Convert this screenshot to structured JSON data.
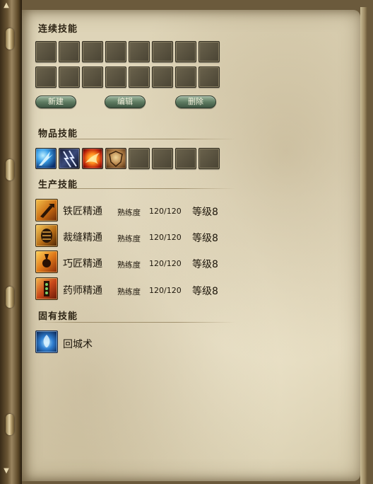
{
  "sections": {
    "combo": "连续技能",
    "item": "物品技能",
    "production": "生产技能",
    "innate": "固有技能"
  },
  "buttons": {
    "new": "新建",
    "edit": "编辑",
    "delete": "删除"
  },
  "item_skill_icons": [
    "ice-spike-icon",
    "lightning-claw-icon",
    "fire-phoenix-icon",
    "golden-shield-icon"
  ],
  "production_skills": [
    {
      "name": "铁匠精通",
      "prof_label": "熟练度",
      "prof_value": "120/120",
      "level": "等级8",
      "icon": "blacksmith-icon"
    },
    {
      "name": "裁缝精通",
      "prof_label": "熟练度",
      "prof_value": "120/120",
      "level": "等级8",
      "icon": "tailor-icon"
    },
    {
      "name": "巧匠精通",
      "prof_label": "熟练度",
      "prof_value": "120/120",
      "level": "等级8",
      "icon": "artisan-icon"
    },
    {
      "name": "药师精通",
      "prof_label": "熟练度",
      "prof_value": "120/120",
      "level": "等级8",
      "icon": "alchemist-icon"
    }
  ],
  "innate_skills": [
    {
      "name": "回城术",
      "icon": "town-portal-icon"
    }
  ],
  "colors": {
    "page": "#e3d9bd",
    "text": "#1e170c",
    "button": "#5f7c62"
  }
}
